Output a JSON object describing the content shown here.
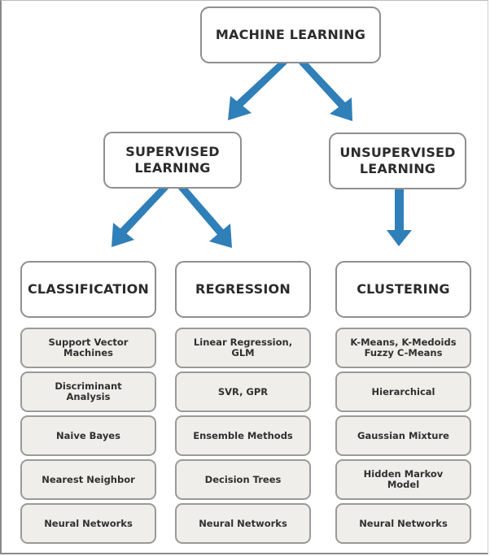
{
  "diagram": {
    "root": {
      "label": "MACHINE LEARNING"
    },
    "branches": [
      {
        "label": "SUPERVISED\nLEARNING"
      },
      {
        "label": "UNSUPERVISED\nLEARNING"
      }
    ],
    "categories": [
      {
        "label": "CLASSIFICATION",
        "parent": "SUPERVISED LEARNING",
        "items": [
          "Support Vector\nMachines",
          "Discriminant\nAnalysis",
          "Naive Bayes",
          "Nearest Neighbor",
          "Neural Networks"
        ]
      },
      {
        "label": "REGRESSION",
        "parent": "SUPERVISED LEARNING",
        "items": [
          "Linear Regression,\nGLM",
          "SVR, GPR",
          "Ensemble Methods",
          "Decision Trees",
          "Neural Networks"
        ]
      },
      {
        "label": "CLUSTERING",
        "parent": "UNSUPERVISED LEARNING",
        "items": [
          "K-Means, K-Medoids\nFuzzy C-Means",
          "Hierarchical",
          "Gaussian Mixture",
          "Hidden Markov\nModel",
          "Neural Networks"
        ]
      }
    ],
    "colors": {
      "arrow": "#2f7fb8",
      "header_box_fill": "#ffffff",
      "item_box_fill": "#efeeeb",
      "box_border": "#8f8f8f",
      "text": "#2b2b2b"
    }
  }
}
